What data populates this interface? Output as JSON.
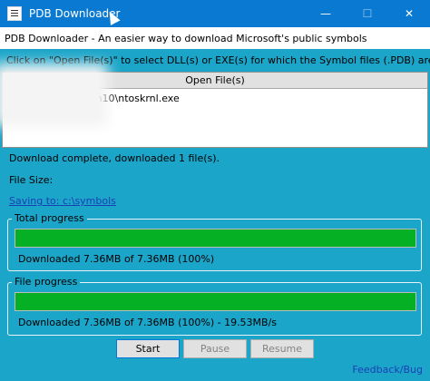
{
  "window": {
    "title": "PDB Downloader",
    "minimize_glyph": "—",
    "maximize_glyph": "☐",
    "close_glyph": "✕"
  },
  "header": {
    "subtitle": "PDB Downloader - An easier way to download Microsoft's public symbols",
    "instruction": "Click on \"Open File(s)\" to select DLL(s) or EXE(s) for which the Symbol files (.PDB) are"
  },
  "file_panel": {
    "open_files_label": "Open File(s)",
    "files": [
      "o\\k\\win10\\ntoskrnl.exe"
    ]
  },
  "status": {
    "download_text": "Download complete, downloaded 1 file(s).",
    "file_size_label": "File Size:",
    "saving_link": "Saving to: c:\\symbols"
  },
  "total_progress": {
    "label": "Total progress",
    "percent": 100,
    "text": "Downloaded 7.36MB of 7.36MB (100%)"
  },
  "file_progress": {
    "label": "File progress",
    "percent": 100,
    "text": "Downloaded 7.36MB of 7.36MB (100%) - 19.53MB/s"
  },
  "buttons": {
    "start": "Start",
    "pause": "Pause",
    "resume": "Resume"
  },
  "footer": {
    "feedback_link": "Feedback/Bug"
  },
  "colors": {
    "titlebar": "#0a79d1",
    "background": "#1ba5c9",
    "progress_fill": "#06b025",
    "link": "#1a3fb5"
  }
}
